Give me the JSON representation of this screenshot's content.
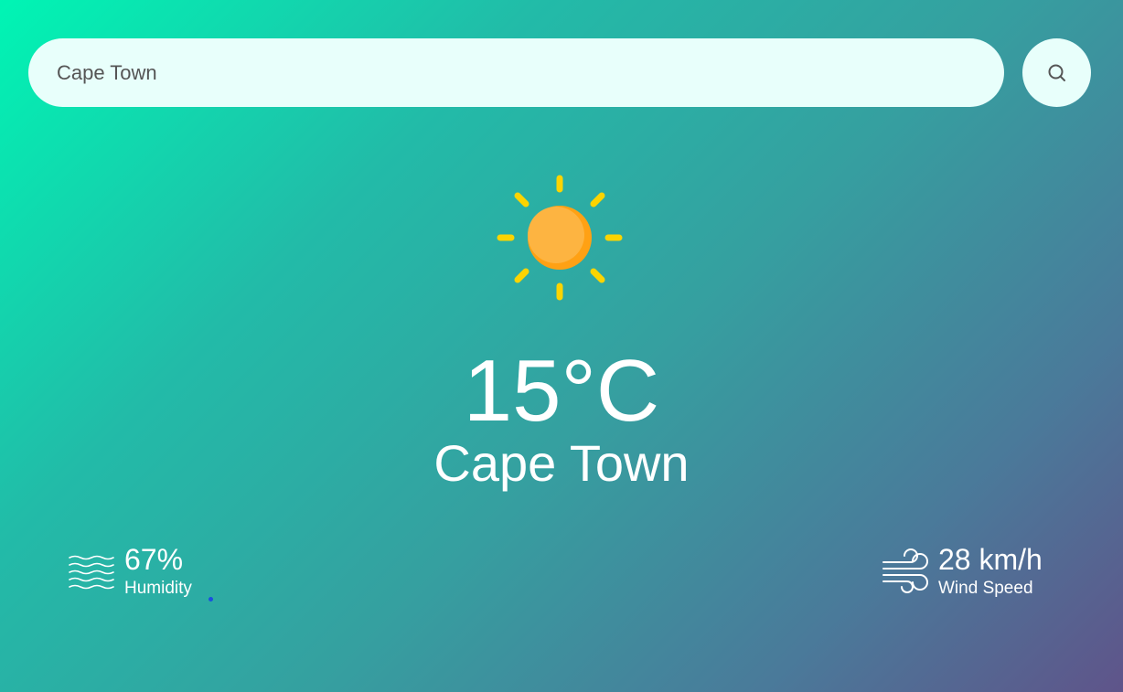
{
  "search": {
    "value": "Cape Town",
    "button_icon": "search-icon"
  },
  "weather": {
    "icon": "sun-icon",
    "temperature": "15°C",
    "city": "Cape Town"
  },
  "humidity": {
    "icon": "humidity-waves-icon",
    "value": "67%",
    "label": "Humidity"
  },
  "wind": {
    "icon": "wind-icon",
    "value": "28 km/h",
    "label": "Wind Speed"
  },
  "colors": {
    "gradient_start": "#00f5b4",
    "gradient_end": "#5f548a",
    "search_bg": "#e8fffb",
    "sun_core": "#fdb441",
    "sun_rays": "#fcd400"
  }
}
